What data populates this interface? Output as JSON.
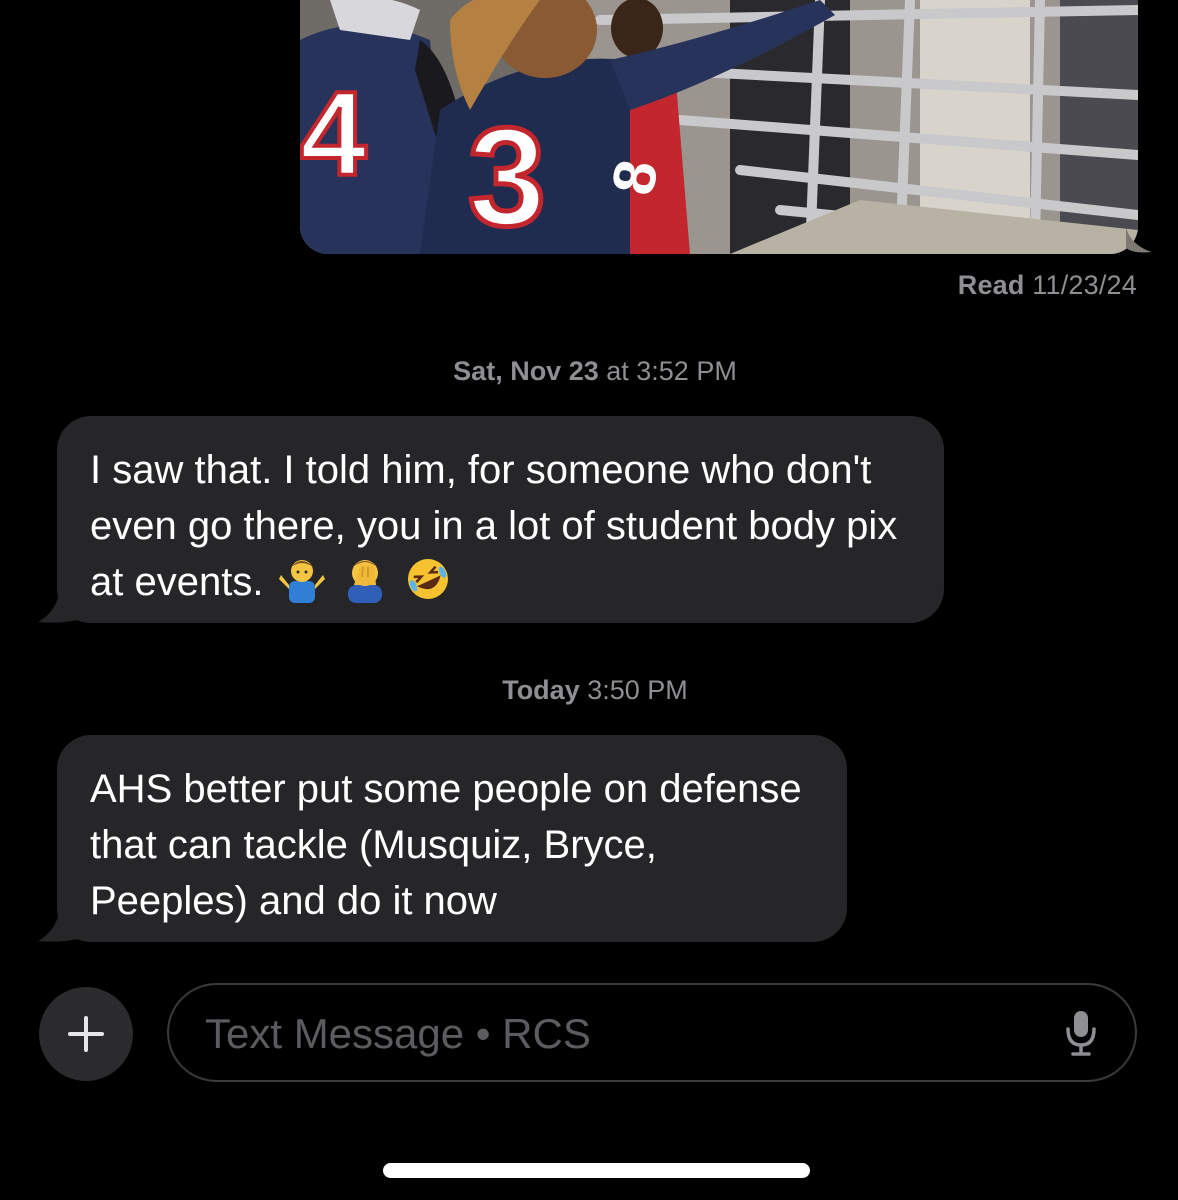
{
  "photo_message": {
    "jersey_numbers": [
      "4",
      "3",
      "8"
    ],
    "read_label": "Read",
    "read_date": "11/23/24"
  },
  "timestamps": [
    {
      "day": "Sat, Nov 23",
      "time": "at 3:52 PM"
    },
    {
      "day": "Today",
      "time": "3:50 PM"
    }
  ],
  "messages": [
    {
      "text": "I saw that. I told him, for someone who don't even go there, you in a lot of student body pix at events.",
      "emojis": [
        "man-shrugging-emoji",
        "man-facepalming-emoji",
        "rolling-on-floor-laughing-emoji"
      ]
    },
    {
      "text": "AHS better put some people on defense that can tackle (Musquiz, Bryce, Peeples) and do it now",
      "emojis": []
    }
  ],
  "composer": {
    "placeholder": "Text Message • RCS",
    "add_icon": "plus-icon",
    "mic_icon": "microphone-icon"
  },
  "colors": {
    "background": "#000000",
    "received_bubble": "#262629",
    "meta_text": "#8e8e93",
    "jersey_navy": "#27335a",
    "jersey_red": "#c4262e"
  }
}
